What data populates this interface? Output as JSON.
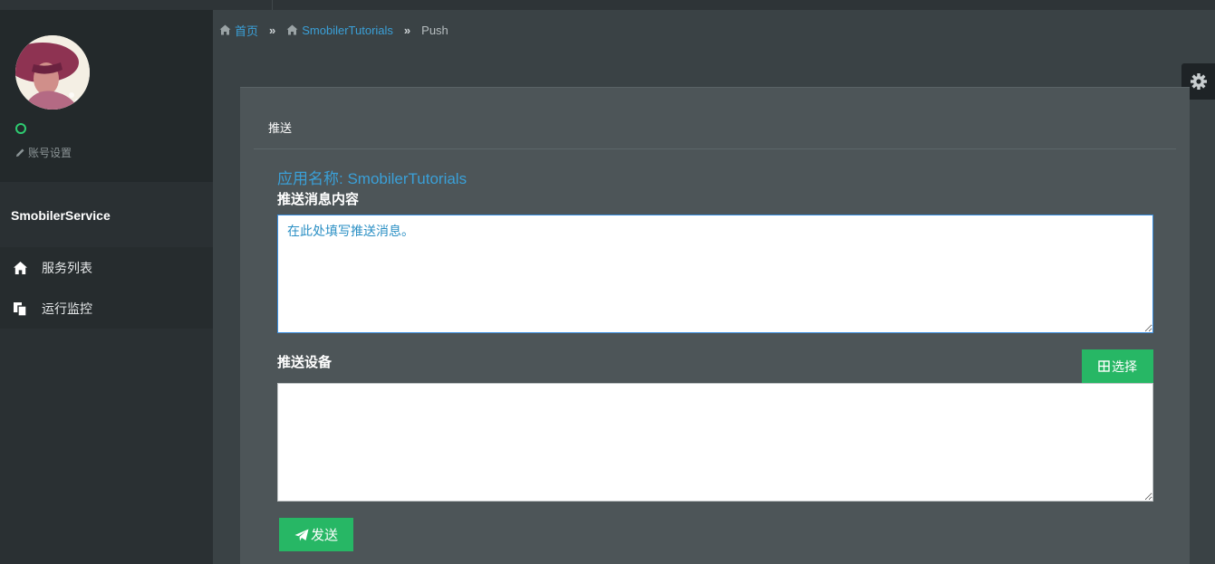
{
  "sidebar": {
    "account_label": "账号设置",
    "service_title": "SmobilerService",
    "menu": [
      {
        "label": "服务列表",
        "icon": "home-icon"
      },
      {
        "label": "运行监控",
        "icon": "copy-icon"
      }
    ]
  },
  "breadcrumb": {
    "home": "首页",
    "app": "SmobilerTutorials",
    "separator": "»",
    "current": "Push"
  },
  "panel": {
    "title": "推送",
    "app_name": "应用名称: SmobilerTutorials",
    "message_label": "推送消息内容",
    "message_value": "在此处填写推送消息。",
    "devices_label": "推送设备",
    "devices_value": "",
    "choose_button": "选择",
    "send_button": "发送"
  },
  "colors": {
    "accent_link": "#3aa0d8",
    "button_green": "#27b765",
    "status_online": "#2ecc71"
  }
}
